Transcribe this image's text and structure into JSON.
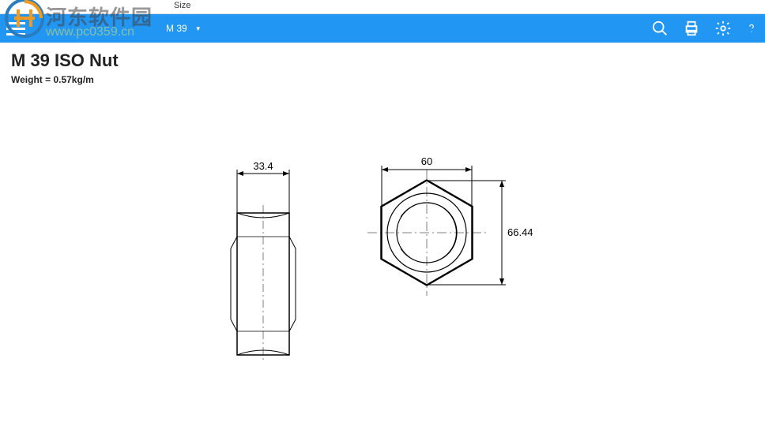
{
  "header": {
    "size_label": "Size",
    "size_selected": "M 39"
  },
  "page": {
    "title": "M 39 ISO Nut",
    "weight_label": "Weight = ",
    "weight_value": "0.57kg/m"
  },
  "watermark": {
    "text": "河东软件园",
    "url": "www.pc0359.cn"
  },
  "drawing": {
    "hex_side_width": "33.4",
    "hex_flat_width": "60",
    "hex_corner_height": "66.44"
  },
  "chart_data": {
    "type": "diagram",
    "part": "ISO Hex Nut",
    "nominal_size": "M 39",
    "views": [
      "side",
      "top"
    ],
    "dimensions": {
      "width_across_flats": 33.4,
      "top_view_flat_width": 60,
      "width_across_corners": 66.44
    },
    "weight_kg_per_m": 0.57
  }
}
